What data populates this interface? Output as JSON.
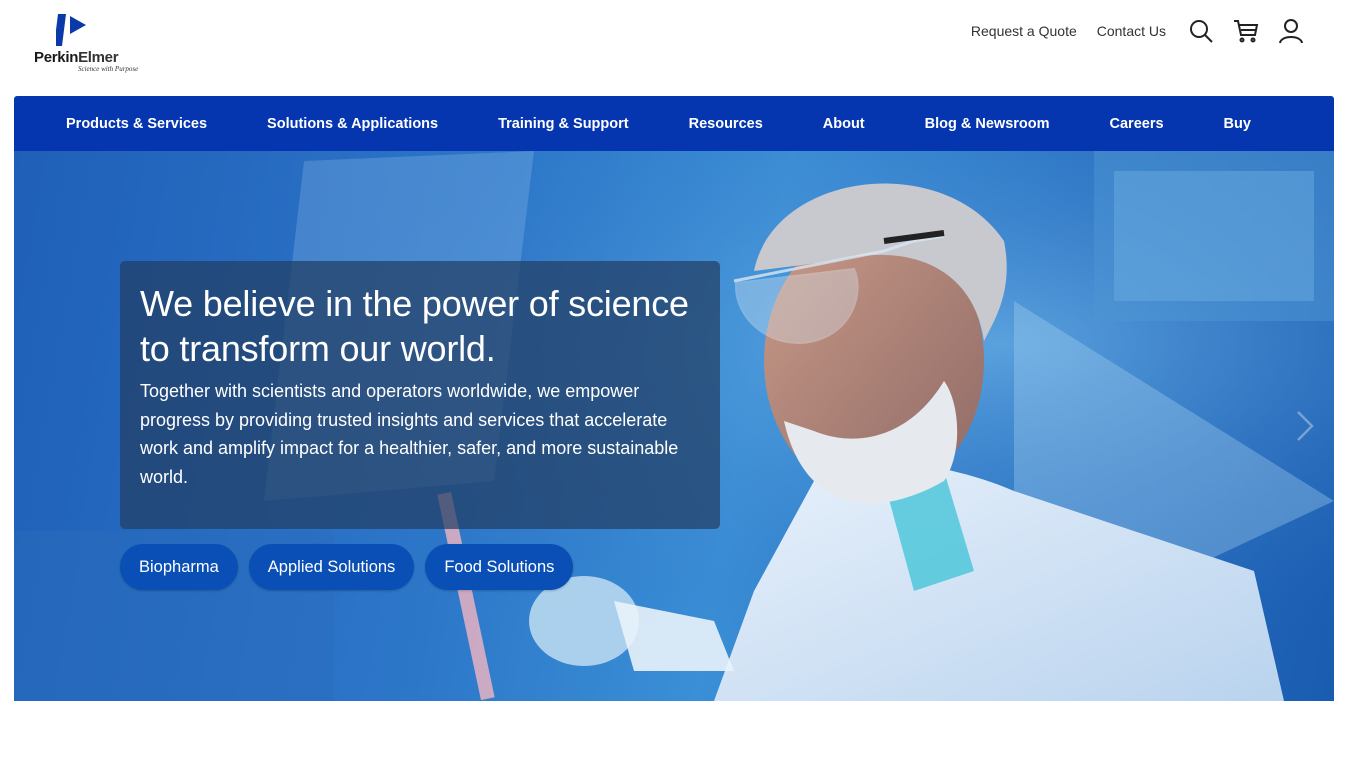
{
  "brand": {
    "name_part1": "Perkin",
    "name_part2": "Elmer",
    "tagline": "Science with Purpose",
    "primary_color": "#0536b0"
  },
  "utility": {
    "request_quote": "Request a Quote",
    "contact_us": "Contact Us",
    "icons": [
      "search-icon",
      "cart-icon",
      "user-icon"
    ]
  },
  "nav": {
    "items": [
      {
        "label": "Products & Services"
      },
      {
        "label": "Solutions & Applications"
      },
      {
        "label": "Training & Support"
      },
      {
        "label": "Resources"
      },
      {
        "label": "About"
      },
      {
        "label": "Blog & Newsroom"
      },
      {
        "label": "Careers"
      },
      {
        "label": "Buy"
      }
    ]
  },
  "hero": {
    "title": "We believe in the power of science to transform our world.",
    "body": "Together with scientists and operators worldwide, we empower progress by providing trusted insights and services that accelerate work and amplify impact for a healthier, safer, and more sustainable world.",
    "chips": [
      {
        "label": "Biopharma"
      },
      {
        "label": "Applied Solutions"
      },
      {
        "label": "Food Solutions"
      }
    ],
    "chip_color": "#0a4fb5"
  }
}
